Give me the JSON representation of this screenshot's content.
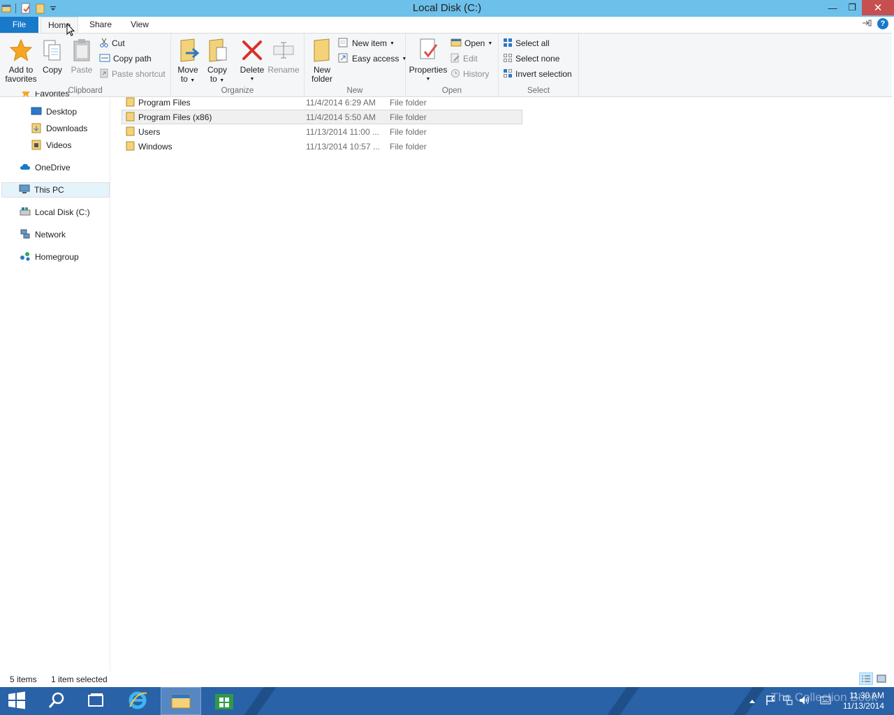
{
  "window": {
    "title": "Local Disk (C:)",
    "minimize": "—",
    "maximize": "❐",
    "close": "✕"
  },
  "ribbon_tabs": [
    "File",
    "Home",
    "Share",
    "View"
  ],
  "help_label": "?",
  "ribbon": {
    "clipboard": {
      "label": "Clipboard",
      "add_to_favorites": [
        "Add to",
        "favorites"
      ],
      "copy": "Copy",
      "paste": "Paste",
      "cut": "Cut",
      "copy_path": "Copy path",
      "paste_shortcut": "Paste shortcut"
    },
    "organize": {
      "label": "Organize",
      "move_to": [
        "Move",
        "to"
      ],
      "copy_to": [
        "Copy",
        "to"
      ],
      "delete": "Delete",
      "rename": "Rename"
    },
    "new": {
      "label": "New",
      "new_folder": [
        "New",
        "folder"
      ],
      "new_item": "New item",
      "easy_access": "Easy access"
    },
    "open": {
      "label": "Open",
      "properties": "Properties",
      "open": "Open",
      "edit": "Edit",
      "history": "History"
    },
    "select": {
      "label": "Select",
      "select_all": "Select all",
      "select_none": "Select none",
      "invert_selection": "Invert selection"
    }
  },
  "nav": {
    "favorites": "Favorites",
    "desktop": "Desktop",
    "downloads": "Downloads",
    "videos": "Videos",
    "onedrive": "OneDrive",
    "this_pc": "This PC",
    "local_disk": "Local Disk (C:)",
    "network": "Network",
    "homegroup": "Homegroup"
  },
  "files": [
    {
      "name": "Program Files",
      "date": "11/4/2014 6:29 AM",
      "type": "File folder"
    },
    {
      "name": "Program Files (x86)",
      "date": "11/4/2014 5:50 AM",
      "type": "File folder"
    },
    {
      "name": "Users",
      "date": "11/13/2014 11:00 ...",
      "type": "File folder"
    },
    {
      "name": "Windows",
      "date": "11/13/2014 10:57 ...",
      "type": "File folder"
    }
  ],
  "status": {
    "items": "5 items",
    "selected": "1 item selected"
  },
  "taskbar": {
    "time": "11:30 AM",
    "date": "11/13/2014",
    "watermark": "The Collection Book"
  }
}
